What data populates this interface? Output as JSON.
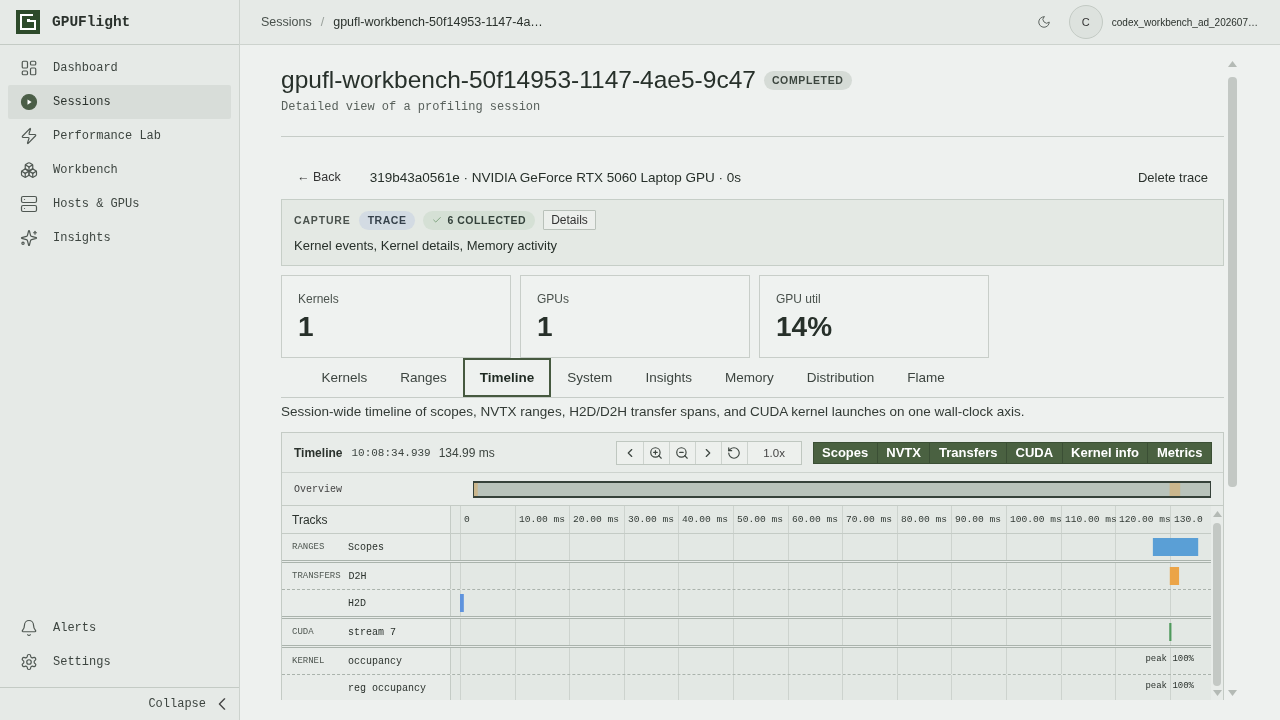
{
  "sidebar": {
    "brand": "GPUFlight",
    "items": [
      {
        "label": "Dashboard",
        "selected": false
      },
      {
        "label": "Sessions",
        "selected": true
      },
      {
        "label": "Performance Lab",
        "selected": false
      },
      {
        "label": "Workbench",
        "selected": false
      },
      {
        "label": "Hosts & GPUs",
        "selected": false
      },
      {
        "label": "Insights",
        "selected": false
      }
    ],
    "footer_items": [
      {
        "label": "Alerts",
        "selected": false
      },
      {
        "label": "Settings",
        "selected": false
      }
    ],
    "collapse": "Collapse"
  },
  "header": {
    "breadcrumbs": [
      "Sessions",
      "gpufl-workbench-50f14953-1147-4a…"
    ],
    "separator": "/",
    "user": {
      "initial": "C",
      "name": "codex_workbench_ad_202607…"
    }
  },
  "session": {
    "title": "gpufl-workbench-50f14953-1147-4ae5-9c47",
    "status": "COMPLETED",
    "subtitle": "Detailed view of a profiling session"
  },
  "trace": {
    "back": "← Back",
    "summary": "319b43a0561e · NVIDIA GeForce RTX 5060 Laptop GPU · 0s",
    "delete": "Delete trace"
  },
  "capture": {
    "label": "CAPTURE",
    "mode": "TRACE",
    "collected": "6 COLLECTED",
    "details": "Details",
    "description": "Kernel events, Kernel details, Memory activity"
  },
  "stats": [
    {
      "label": "Kernels",
      "value": "1"
    },
    {
      "label": "GPUs",
      "value": "1"
    },
    {
      "label": "GPU util",
      "value": "14%"
    }
  ],
  "tabs": [
    {
      "label": "Kernels",
      "selected": false
    },
    {
      "label": "Ranges",
      "selected": false
    },
    {
      "label": "Timeline",
      "selected": true
    },
    {
      "label": "System",
      "selected": false
    },
    {
      "label": "Insights",
      "selected": false
    },
    {
      "label": "Memory",
      "selected": false
    },
    {
      "label": "Distribution",
      "selected": false
    },
    {
      "label": "Flame",
      "selected": false
    }
  ],
  "tab_description": "Session-wide timeline of scopes, NVTX ranges, H2D/D2H transfer spans, and CUDA kernel launches on one wall-clock axis.",
  "timeline": {
    "title": "Timeline",
    "start_time": "10:08:34.939",
    "duration": "134.99 ms",
    "zoom": "1.0x",
    "toggles": [
      {
        "label": "Scopes",
        "selected": true
      },
      {
        "label": "NVTX",
        "selected": true
      },
      {
        "label": "Transfers",
        "selected": true
      },
      {
        "label": "CUDA",
        "selected": true
      },
      {
        "label": "Kernel info",
        "selected": true
      },
      {
        "label": "Metrics",
        "selected": true
      }
    ],
    "overview": "Overview",
    "tracks": {
      "label": "Tracks",
      "axis_labels": [
        "0",
        "10.00 ms",
        "20.00 ms",
        "30.00 ms",
        "40.00 ms",
        "50.00 ms",
        "60.00 ms",
        "70.00 ms",
        "80.00 ms",
        "90.00 ms",
        "100.00 ms",
        "110.00 ms",
        "120.00 ms",
        "130.0"
      ],
      "rows": [
        {
          "group": "RANGES",
          "label": "Scopes",
          "kind": "span",
          "color": "#5a9fd6"
        },
        {
          "group": "TRANSFERS",
          "label": "D2H",
          "kind": "span",
          "color": "#eba447"
        },
        {
          "label": "H2D",
          "kind": "span",
          "color": "#5f93dd"
        },
        {
          "group": "CUDA",
          "label": "stream 7",
          "kind": "span",
          "color": "#4f9a5c"
        },
        {
          "group": "KERNEL",
          "label": "occupancy",
          "kind": "metric",
          "peak": "peak 100%"
        },
        {
          "label": "reg occupancy",
          "kind": "metric",
          "peak": "peak 100%"
        }
      ]
    }
  }
}
